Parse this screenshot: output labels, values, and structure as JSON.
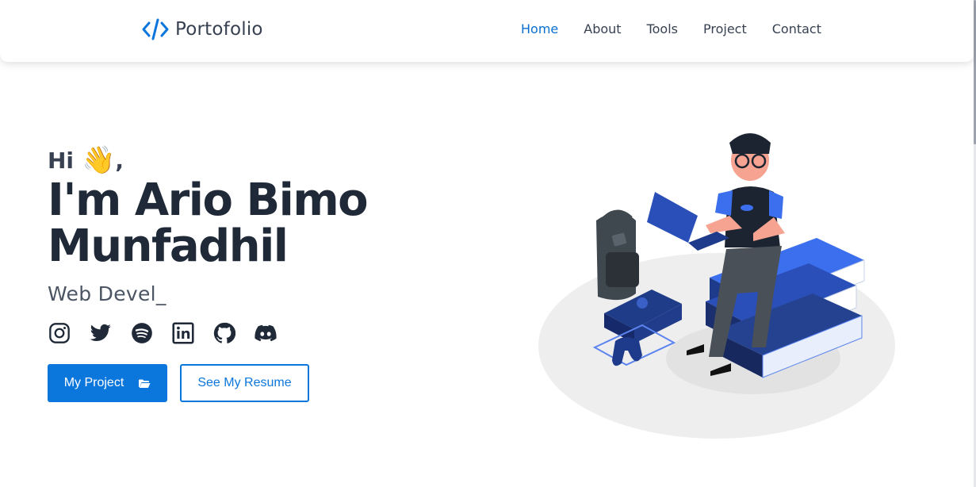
{
  "nav": {
    "brand_label": "Portofolio",
    "links": [
      {
        "label": "Home",
        "active": true
      },
      {
        "label": "About"
      },
      {
        "label": "Tools"
      },
      {
        "label": "Project"
      },
      {
        "label": "Contact"
      }
    ]
  },
  "hero": {
    "greeting": "Hi",
    "wave_emoji": "👋",
    "greeting_suffix": ",",
    "name_line1": "I'm Ario Bimo",
    "name_line2": "Munfadhil",
    "role": "Web Devel_",
    "socials": [
      "instagram-icon",
      "twitter-icon",
      "spotify-icon",
      "linkedin-icon",
      "github-icon",
      "discord-icon"
    ],
    "primary_button": "My Project",
    "secondary_button": "See My Resume"
  },
  "colors": {
    "accent": "#0b76db",
    "text_dark": "#1f2937"
  }
}
